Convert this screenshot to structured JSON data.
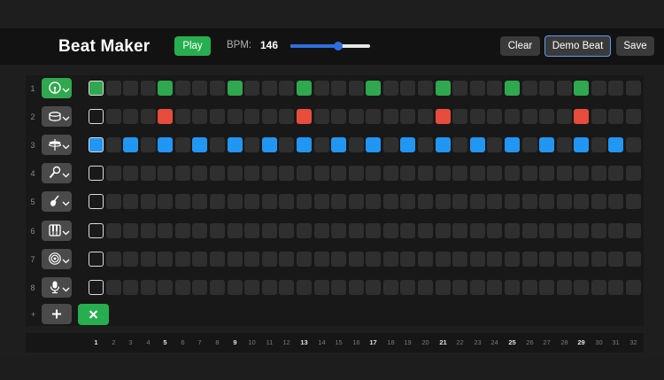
{
  "app": {
    "title": "Beat Maker"
  },
  "header": {
    "play_label": "Play",
    "bpm_label": "BPM:",
    "bpm_value": "146",
    "clear_label": "Clear",
    "demo_label": "Demo Beat",
    "save_label": "Save",
    "tempo_slider": {
      "level_fraction": 0.6
    }
  },
  "colors": {
    "accent_green": "#27ae50",
    "snare_red": "#e74c3c",
    "hihat_blue": "#2196f3",
    "focus_blue": "#5e9cf0",
    "cell_inactive": "#2f2f2f"
  },
  "tracks": [
    {
      "number": "1",
      "instrument_icon": "kick-drum-icon",
      "selected": true,
      "color": "#2fa84f",
      "active_steps": [
        1,
        5,
        9,
        13,
        17,
        21,
        25,
        29
      ]
    },
    {
      "number": "2",
      "instrument_icon": "snare-drum-icon",
      "selected": false,
      "color": "#e74c3c",
      "active_steps": [
        5,
        13,
        21,
        29
      ]
    },
    {
      "number": "3",
      "instrument_icon": "hihat-cymbal-icon",
      "selected": false,
      "color": "#2196f3",
      "active_steps": [
        1,
        3,
        5,
        7,
        9,
        11,
        13,
        15,
        17,
        19,
        21,
        23,
        25,
        27,
        29,
        31
      ]
    },
    {
      "number": "4",
      "instrument_icon": "microphone-icon",
      "selected": false,
      "color": "#2196f3",
      "active_steps": []
    },
    {
      "number": "5",
      "instrument_icon": "guitar-icon",
      "selected": false,
      "color": "#2196f3",
      "active_steps": []
    },
    {
      "number": "6",
      "instrument_icon": "piano-keys-icon",
      "selected": false,
      "color": "#2196f3",
      "active_steps": []
    },
    {
      "number": "7",
      "instrument_icon": "speaker-icon",
      "selected": false,
      "color": "#2196f3",
      "active_steps": []
    },
    {
      "number": "8",
      "instrument_icon": "vocal-mic-icon",
      "selected": false,
      "color": "#2196f3",
      "active_steps": []
    }
  ],
  "add_row": {
    "label": "+",
    "add_icon": "plus-icon",
    "delete_icon": "close-icon"
  },
  "steps": [
    "1",
    "2",
    "3",
    "4",
    "5",
    "6",
    "7",
    "8",
    "9",
    "10",
    "11",
    "12",
    "13",
    "14",
    "15",
    "16",
    "17",
    "18",
    "19",
    "20",
    "21",
    "22",
    "23",
    "24",
    "25",
    "26",
    "27",
    "28",
    "29",
    "30",
    "31",
    "32"
  ],
  "beat_steps": [
    1,
    5,
    9,
    13,
    17,
    21,
    25,
    29
  ]
}
